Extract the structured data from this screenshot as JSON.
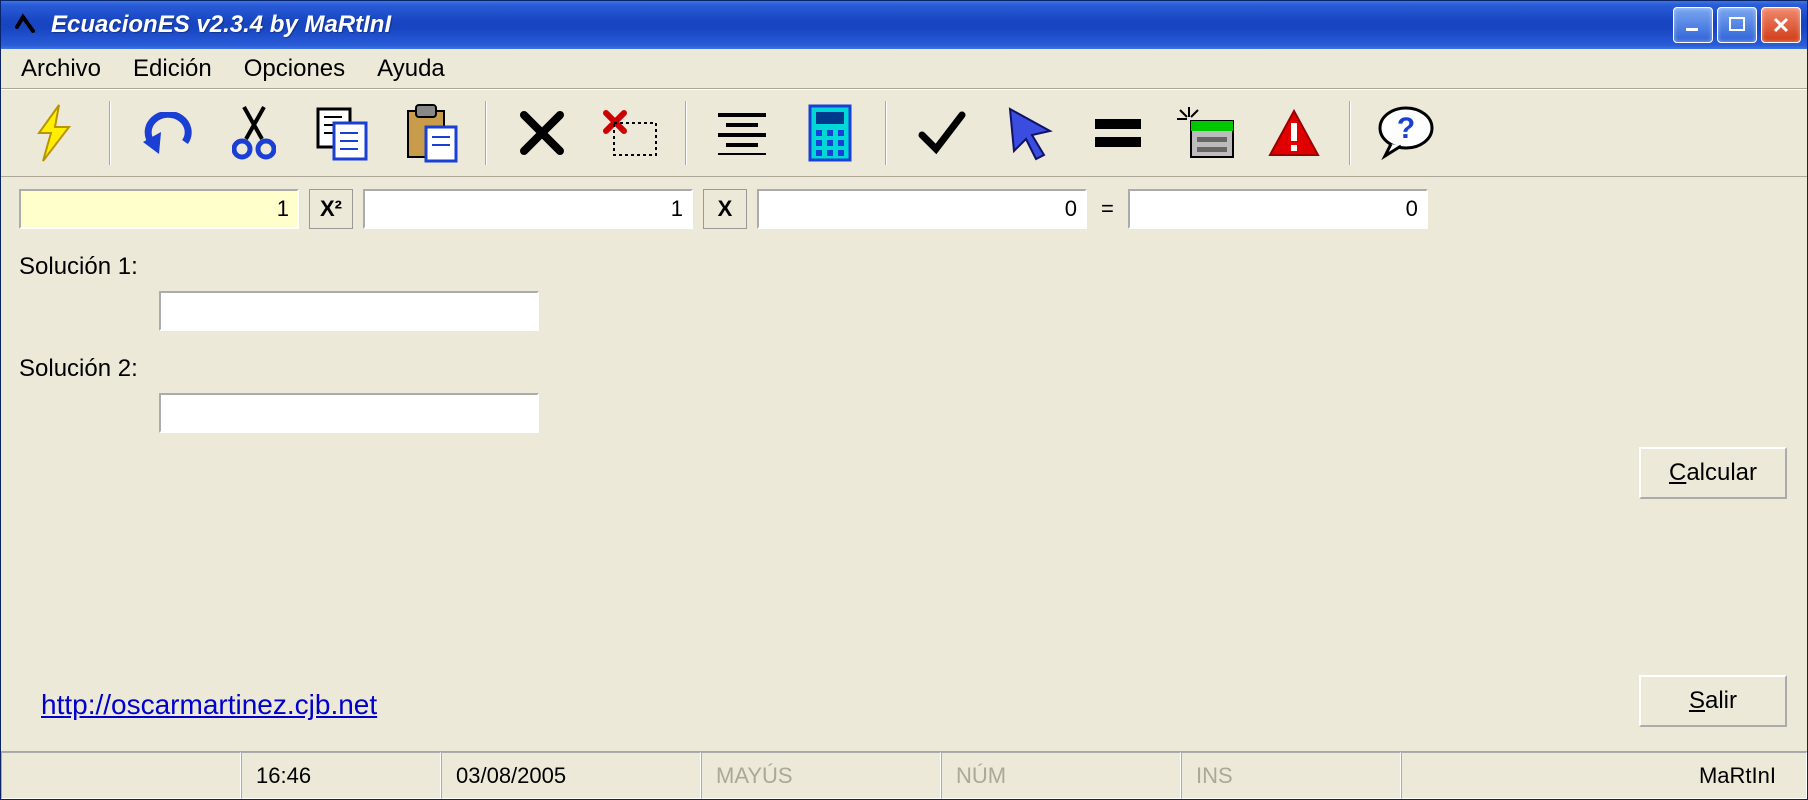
{
  "titlebar": {
    "title": "EcuacionES v2.3.4 by MaRtInI"
  },
  "menu": {
    "items": [
      "Archivo",
      "Edición",
      "Opciones",
      "Ayuda"
    ]
  },
  "toolbar": {
    "icons": [
      "lightning",
      "undo",
      "cut",
      "copy",
      "paste",
      "delete",
      "delete-row",
      "justify",
      "calculator",
      "check",
      "cursor",
      "equals",
      "pointer-panel",
      "warning",
      "help"
    ]
  },
  "equation": {
    "coef_a": "1",
    "lbl_x2": "X²",
    "coef_b": "1",
    "lbl_x": "X",
    "coef_c": "0",
    "equals": "=",
    "result": "0"
  },
  "solutions": {
    "label1": "Solución 1:",
    "value1": "",
    "label2": "Solución 2:",
    "value2": ""
  },
  "link": {
    "text": "http://oscarmartinez.cjb.net"
  },
  "buttons": {
    "calcular": "Calcular",
    "salir": "Salir"
  },
  "statusbar": {
    "cell1": "",
    "time": "16:46",
    "date": "03/08/2005",
    "caps": "MAYÚS",
    "num": "NÚM",
    "ins": "INS",
    "author": "MaRtInI"
  }
}
